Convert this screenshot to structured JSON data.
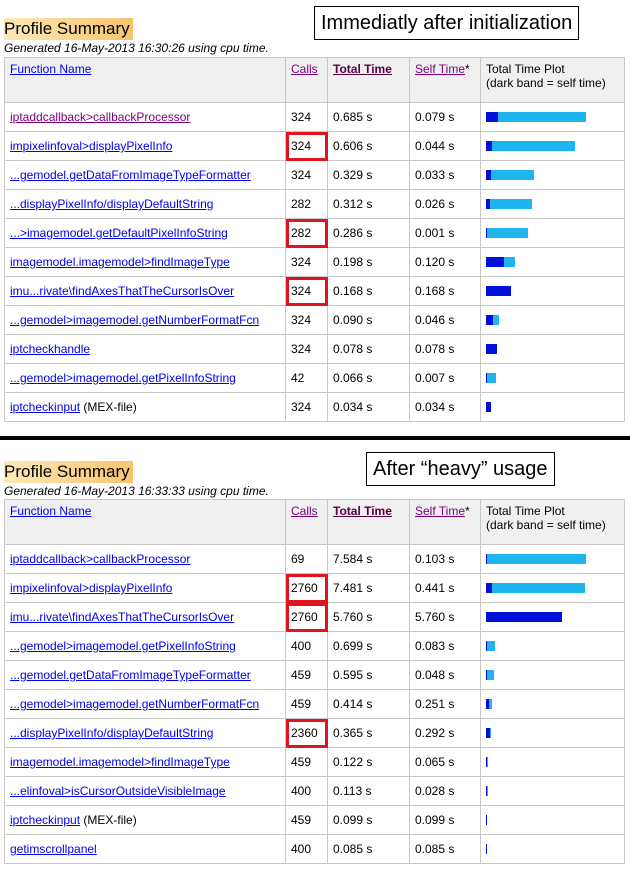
{
  "colors": {
    "total_band": "#1eb4ee",
    "self_band": "#0010d8",
    "highlight": "#e0141e"
  },
  "headers": {
    "function_name": "Function Name",
    "calls": "Calls",
    "total_time": "Total Time",
    "self_time": "Self Time",
    "self_time_star": "*",
    "plot_line1": "Total Time Plot",
    "plot_line2": "(dark band = self time)"
  },
  "top": {
    "title": "Profile Summary",
    "generated": "Generated 16-May-2013 16:30:26 using cpu time.",
    "callout": "Immediatly after initialization",
    "rows": [
      {
        "name": "iptaddcallback>callbackProcessor",
        "suffix": "",
        "calls": "324",
        "total": "0.685 s",
        "self": "0.079 s",
        "total_frac": 1.0,
        "self_frac": 0.115,
        "highlight": false,
        "visited": true
      },
      {
        "name": "impixelinfoval>displayPixelInfo",
        "suffix": "",
        "calls": "324",
        "total": "0.606 s",
        "self": "0.044 s",
        "total_frac": 0.885,
        "self_frac": 0.064,
        "highlight": true,
        "visited": false
      },
      {
        "name": "...gemodel.getDataFromImageTypeFormatter",
        "suffix": "",
        "calls": "324",
        "total": "0.329 s",
        "self": "0.033 s",
        "total_frac": 0.48,
        "self_frac": 0.048,
        "highlight": false,
        "visited": false
      },
      {
        "name": "...displayPixelInfo/displayDefaultString",
        "suffix": "",
        "calls": "282",
        "total": "0.312 s",
        "self": "0.026 s",
        "total_frac": 0.455,
        "self_frac": 0.038,
        "highlight": false,
        "visited": false
      },
      {
        "name": "...>imagemodel.getDefaultPixelInfoString",
        "suffix": "",
        "calls": "282",
        "total": "0.286 s",
        "self": "0.001 s",
        "total_frac": 0.418,
        "self_frac": 0.002,
        "highlight": true,
        "visited": false
      },
      {
        "name": "imagemodel.imagemodel>findImageType",
        "suffix": "",
        "calls": "324",
        "total": "0.198 s",
        "self": "0.120 s",
        "total_frac": 0.289,
        "self_frac": 0.175,
        "highlight": false,
        "visited": false
      },
      {
        "name": "imu...rivate\\findAxesThatTheCursorIsOver",
        "suffix": "",
        "calls": "324",
        "total": "0.168 s",
        "self": "0.168 s",
        "total_frac": 0.245,
        "self_frac": 0.245,
        "highlight": true,
        "visited": false
      },
      {
        "name": "...gemodel>imagemodel.getNumberFormatFcn",
        "suffix": "",
        "calls": "324",
        "total": "0.090 s",
        "self": "0.046 s",
        "total_frac": 0.131,
        "self_frac": 0.067,
        "highlight": false,
        "visited": false
      },
      {
        "name": "iptcheckhandle",
        "suffix": "",
        "calls": "324",
        "total": "0.078 s",
        "self": "0.078 s",
        "total_frac": 0.114,
        "self_frac": 0.114,
        "highlight": false,
        "visited": false
      },
      {
        "name": "...gemodel>imagemodel.getPixelInfoString",
        "suffix": "",
        "calls": "42",
        "total": "0.066 s",
        "self": "0.007 s",
        "total_frac": 0.096,
        "self_frac": 0.01,
        "highlight": false,
        "visited": false
      },
      {
        "name": "iptcheckinput",
        "suffix": " (MEX-file)",
        "calls": "324",
        "total": "0.034 s",
        "self": "0.034 s",
        "total_frac": 0.05,
        "self_frac": 0.05,
        "highlight": false,
        "visited": false
      }
    ]
  },
  "bottom": {
    "title": "Profile Summary",
    "generated": "Generated 16-May-2013 16:33:33 using cpu time.",
    "callout": "After “heavy” usage",
    "rows": [
      {
        "name": "iptaddcallback>callbackProcessor",
        "suffix": "",
        "calls": "69",
        "total": "7.584 s",
        "self": "0.103 s",
        "total_frac": 1.0,
        "self_frac": 0.014,
        "highlight": false,
        "visited": false
      },
      {
        "name": "impixelinfoval>displayPixelInfo",
        "suffix": "",
        "calls": "2760",
        "total": "7.481 s",
        "self": "0.441 s",
        "total_frac": 0.986,
        "self_frac": 0.058,
        "highlight": true,
        "visited": false
      },
      {
        "name": "imu...rivate\\findAxesThatTheCursorIsOver",
        "suffix": "",
        "calls": "2760",
        "total": "5.760 s",
        "self": "5.760 s",
        "total_frac": 0.76,
        "self_frac": 0.76,
        "highlight": true,
        "visited": false
      },
      {
        "name": "...gemodel>imagemodel.getPixelInfoString",
        "suffix": "",
        "calls": "400",
        "total": "0.699 s",
        "self": "0.083 s",
        "total_frac": 0.092,
        "self_frac": 0.011,
        "highlight": false,
        "visited": false
      },
      {
        "name": "...gemodel.getDataFromImageTypeFormatter",
        "suffix": "",
        "calls": "459",
        "total": "0.595 s",
        "self": "0.048 s",
        "total_frac": 0.078,
        "self_frac": 0.006,
        "highlight": false,
        "visited": false
      },
      {
        "name": "...gemodel>imagemodel.getNumberFormatFcn",
        "suffix": "",
        "calls": "459",
        "total": "0.414 s",
        "self": "0.251 s",
        "total_frac": 0.055,
        "self_frac": 0.033,
        "highlight": false,
        "visited": false
      },
      {
        "name": "...displayPixelInfo/displayDefaultString",
        "suffix": "",
        "calls": "2360",
        "total": "0.365 s",
        "self": "0.292 s",
        "total_frac": 0.048,
        "self_frac": 0.038,
        "highlight": true,
        "visited": false
      },
      {
        "name": "imagemodel.imagemodel>findImageType",
        "suffix": "",
        "calls": "459",
        "total": "0.122 s",
        "self": "0.065 s",
        "total_frac": 0.016,
        "self_frac": 0.009,
        "highlight": false,
        "visited": false
      },
      {
        "name": "...elinfoval>isCursorOutsideVisibleImage",
        "suffix": "",
        "calls": "400",
        "total": "0.113 s",
        "self": "0.028 s",
        "total_frac": 0.015,
        "self_frac": 0.004,
        "highlight": false,
        "visited": false
      },
      {
        "name": "iptcheckinput",
        "suffix": " (MEX-file)",
        "calls": "459",
        "total": "0.099 s",
        "self": "0.099 s",
        "total_frac": 0.013,
        "self_frac": 0.013,
        "highlight": false,
        "visited": false
      },
      {
        "name": "getimscrollpanel",
        "suffix": "",
        "calls": "400",
        "total": "0.085 s",
        "self": "0.085 s",
        "total_frac": 0.011,
        "self_frac": 0.011,
        "highlight": false,
        "visited": false
      }
    ]
  }
}
